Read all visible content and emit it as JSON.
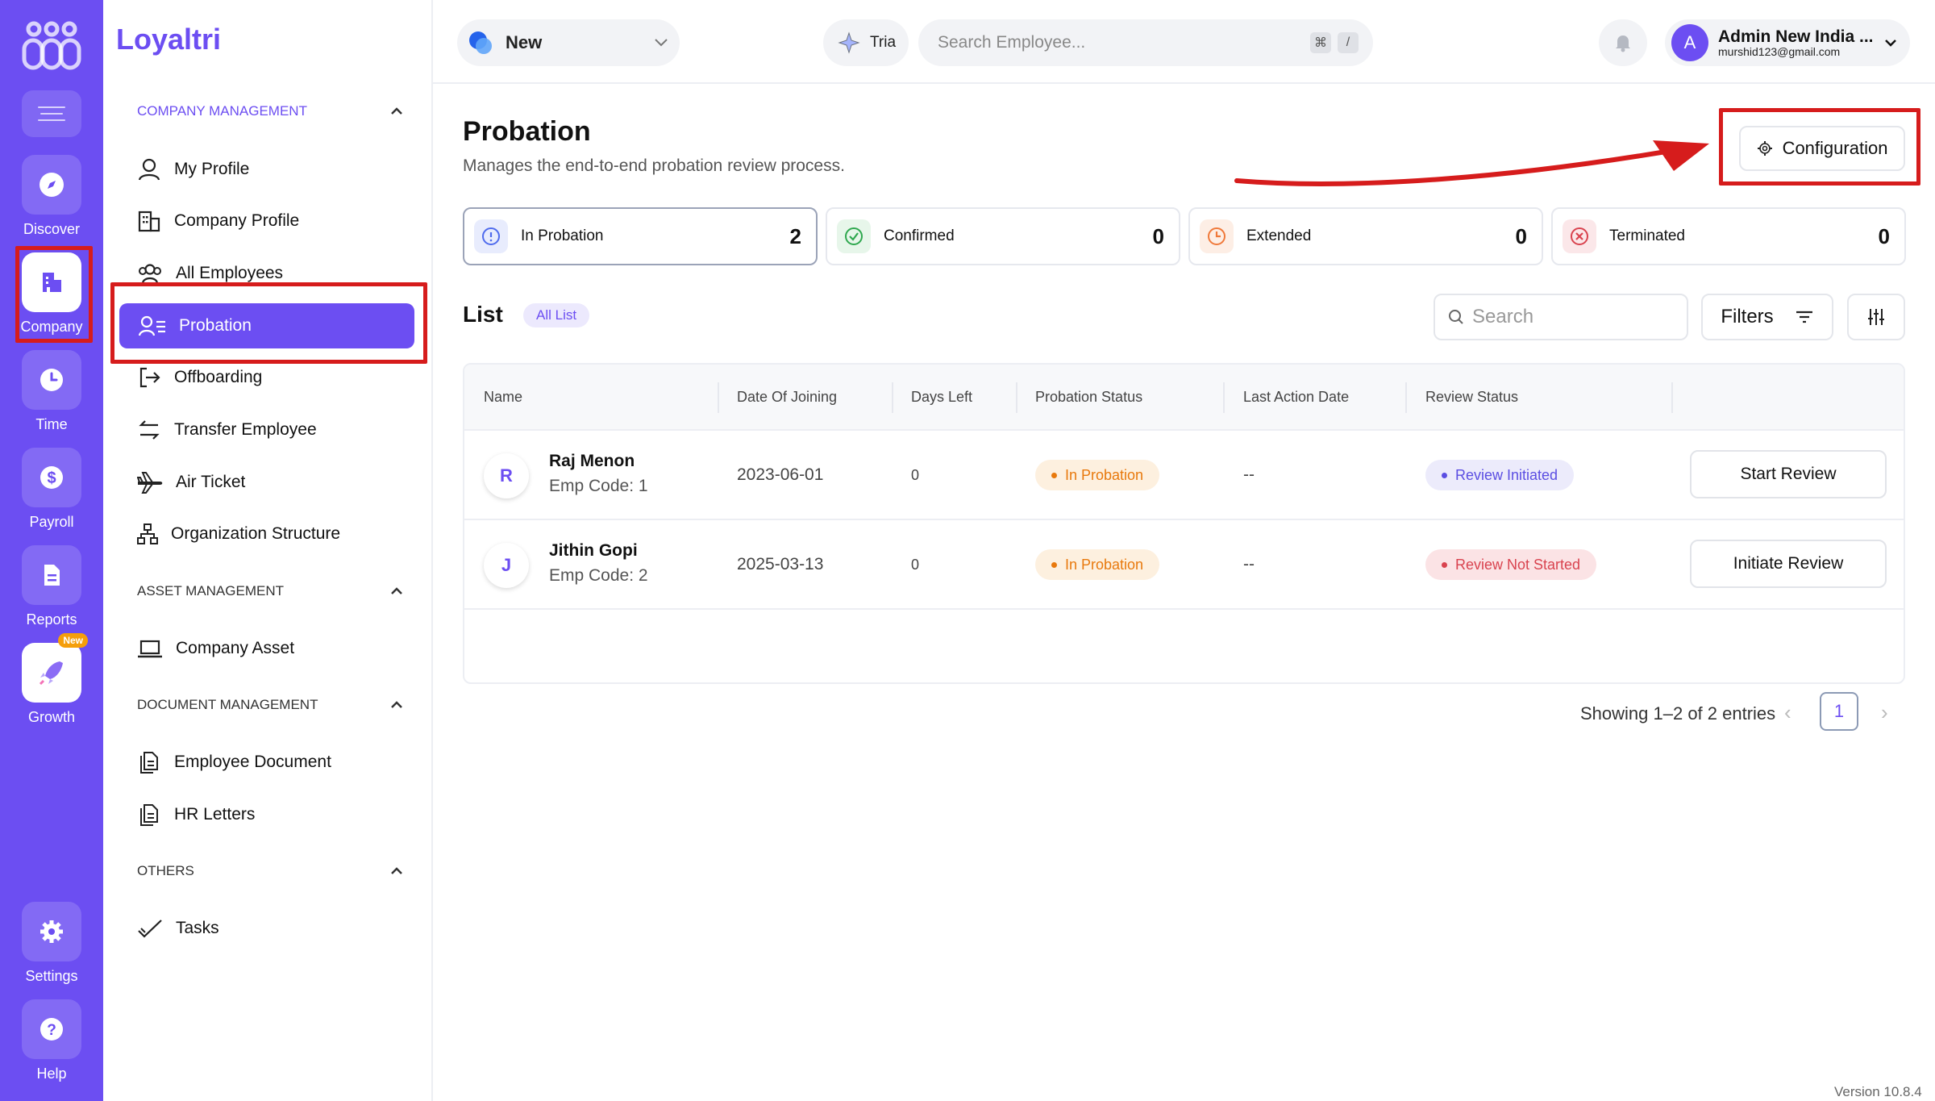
{
  "brand": {
    "name": "Loyaltri",
    "accent": "#6c4ef2"
  },
  "rail": {
    "items": [
      {
        "label": "Discover",
        "icon": "compass-icon"
      },
      {
        "label": "Company",
        "icon": "building-icon"
      },
      {
        "label": "Time",
        "icon": "clock-icon"
      },
      {
        "label": "Payroll",
        "icon": "dollar-icon"
      },
      {
        "label": "Reports",
        "icon": "document-icon"
      },
      {
        "label": "Growth",
        "icon": "rocket-icon",
        "badge": "New"
      },
      {
        "label": "Settings",
        "icon": "gear-icon"
      },
      {
        "label": "Help",
        "icon": "help-icon"
      }
    ]
  },
  "sidebar": {
    "company_section": "COMPANY MANAGEMENT",
    "company_items": [
      "My Profile",
      "Company Profile",
      "All Employees",
      "Probation",
      "Offboarding",
      "Transfer Employee",
      "Air Ticket",
      "Organization Structure"
    ],
    "asset_section": "ASSET MANAGEMENT",
    "asset_items": [
      "Company Asset"
    ],
    "document_section": "DOCUMENT MANAGEMENT",
    "document_items": [
      "Employee Document",
      "HR Letters"
    ],
    "others_section": "OTHERS",
    "others_items": [
      "Tasks"
    ]
  },
  "topbar": {
    "workspace": "New",
    "assistant": "Tria",
    "search_placeholder": "Search Employee...",
    "shortcut_cmd": "⌘",
    "shortcut_key": "/",
    "user_initial": "A",
    "user_name": "Admin New India ...",
    "user_email": "murshid123@gmail.com"
  },
  "page": {
    "title": "Probation",
    "subtitle": "Manages the end-to-end probation review process.",
    "config_label": "Configuration"
  },
  "stats": [
    {
      "label": "In Probation",
      "value": "2",
      "color": "#4f6bed"
    },
    {
      "label": "Confirmed",
      "value": "0",
      "color": "#2fa84f"
    },
    {
      "label": "Extended",
      "value": "0",
      "color": "#f0793a"
    },
    {
      "label": "Terminated",
      "value": "0",
      "color": "#d9434f"
    }
  ],
  "list": {
    "title": "List",
    "filter_chip": "All List",
    "search_placeholder": "Search",
    "filters_label": "Filters",
    "columns": [
      "Name",
      "Date Of Joining",
      "Days Left",
      "Probation Status",
      "Last Action Date",
      "Review Status"
    ],
    "rows": [
      {
        "initial": "R",
        "name": "Raj Menon",
        "code": "Emp Code: 1",
        "doj": "2023-06-01",
        "days_left": "0",
        "probation_status": "In Probation",
        "last_action": "--",
        "review_status": "Review Initiated",
        "action": "Start Review"
      },
      {
        "initial": "J",
        "name": "Jithin Gopi",
        "code": "Emp Code: 2",
        "doj": "2025-03-13",
        "days_left": "0",
        "probation_status": "In Probation",
        "last_action": "--",
        "review_status": "Review Not Started",
        "action": "Initiate Review"
      }
    ],
    "showing": "Showing 1–2 of 2 entries",
    "page": "1",
    "prev": "‹",
    "next": "›"
  },
  "version": "Version 10.8.4"
}
